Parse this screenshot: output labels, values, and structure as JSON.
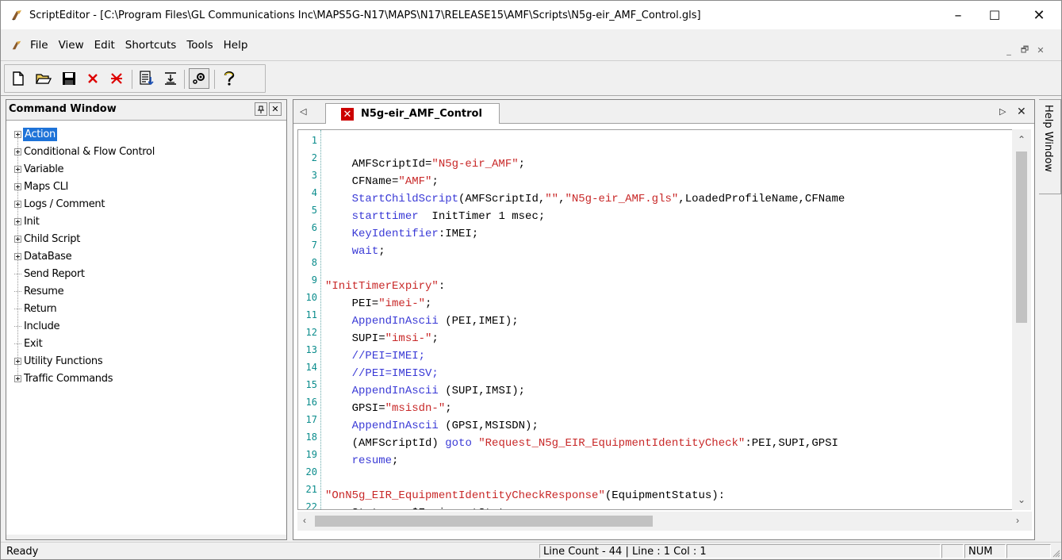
{
  "window": {
    "title": "ScriptEditor - [C:\\Program Files\\GL Communications Inc\\MAPS5G-N17\\MAPS\\N17\\RELEASE15\\AMF\\Scripts\\N5g-eir_AMF_Control.gls]",
    "minimize": "–",
    "maximize": "☐",
    "close": "✕"
  },
  "menu": [
    "File",
    "View",
    "Edit",
    "Shortcuts",
    "Tools",
    "Help"
  ],
  "mdi_controls": [
    "_",
    "🗗",
    "✕"
  ],
  "command_window": {
    "title": "Command Window",
    "pin": "📌",
    "close": "✕",
    "items": [
      {
        "label": "Action",
        "expandable": true,
        "selected": true
      },
      {
        "label": "Conditional & Flow Control",
        "expandable": true
      },
      {
        "label": "Variable",
        "expandable": true
      },
      {
        "label": "Maps CLI",
        "expandable": true
      },
      {
        "label": "Logs / Comment",
        "expandable": true
      },
      {
        "label": "Init",
        "expandable": true
      },
      {
        "label": "Child Script",
        "expandable": true
      },
      {
        "label": "DataBase",
        "expandable": true
      },
      {
        "label": "Send Report",
        "expandable": false
      },
      {
        "label": "Resume",
        "expandable": false
      },
      {
        "label": "Return",
        "expandable": false
      },
      {
        "label": "Include",
        "expandable": false
      },
      {
        "label": "Exit",
        "expandable": false
      },
      {
        "label": "Utility Functions",
        "expandable": true
      },
      {
        "label": "Traffic Commands",
        "expandable": true
      }
    ]
  },
  "editor": {
    "tab_label": "N5g-eir_AMF_Control",
    "line_numbers": [
      "1",
      "2",
      "3",
      "4",
      "5",
      "6",
      "7",
      "8",
      "9",
      "10",
      "11",
      "12",
      "13",
      "14",
      "15",
      "16",
      "17",
      "18",
      "19",
      "20",
      "21",
      "22"
    ]
  },
  "help_window": {
    "label": "Help Window"
  },
  "status": {
    "ready": "Ready",
    "line_info": "Line Count - 44 | Line : 1 Col : 1",
    "num": "NUM"
  },
  "colors": {
    "keyword": "#3a3ad6",
    "string": "#c82828",
    "selection": "#1e73d8",
    "line_number": "#0a8c8c"
  }
}
